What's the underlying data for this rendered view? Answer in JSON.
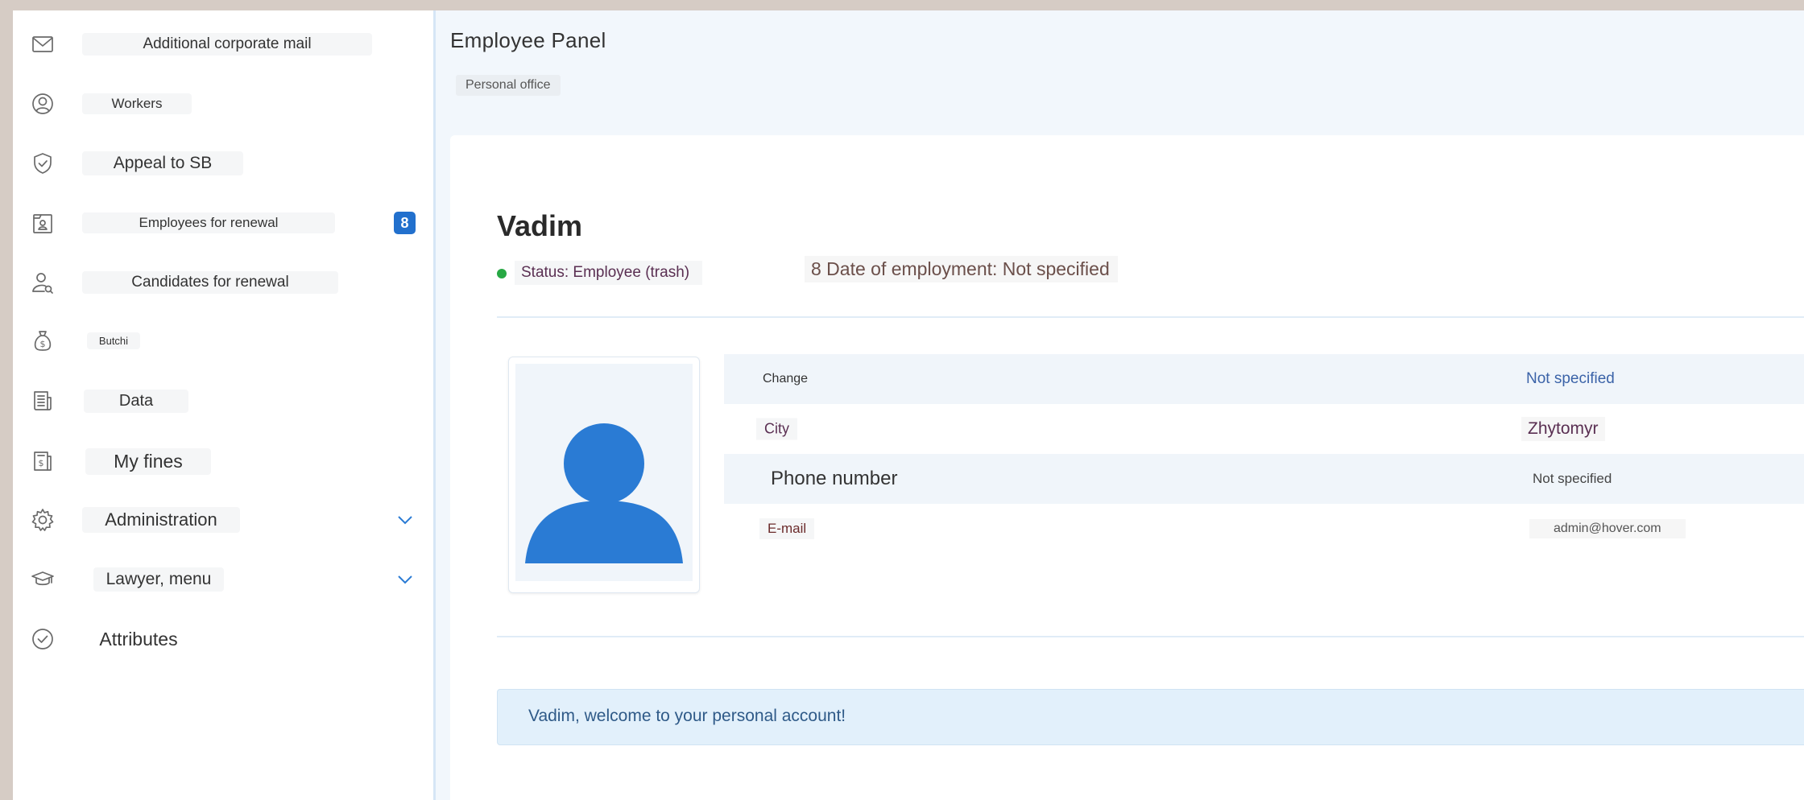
{
  "sidebar": {
    "items": [
      {
        "label": "Additional corporate mail",
        "icon": "mail-icon"
      },
      {
        "label": "Workers",
        "icon": "user-circle-icon"
      },
      {
        "label": "Appeal to SB",
        "icon": "shield-check-icon"
      },
      {
        "label": "Employees for renewal",
        "icon": "id-card-icon",
        "badge": "8"
      },
      {
        "label": "Candidates for renewal",
        "icon": "user-search-icon"
      },
      {
        "label": "Butchi",
        "icon": "money-bag-icon"
      },
      {
        "label": "Data",
        "icon": "document-icon"
      },
      {
        "label": "My fines",
        "icon": "receipt-icon"
      },
      {
        "label": "Administration",
        "icon": "gear-icon",
        "expandable": true
      },
      {
        "label": "Lawyer, menu",
        "icon": "graduation-cap-icon",
        "expandable": true
      },
      {
        "label": "Attributes",
        "icon": "check-circle-icon"
      }
    ]
  },
  "header": {
    "title": "Employee Panel",
    "breadcrumb": "Personal office"
  },
  "profile": {
    "name": "Vadim",
    "status": "Status: Employee (trash)",
    "employment": "8 Date of employment: Not specified",
    "fields": [
      {
        "key": "Change",
        "value": "Not specified"
      },
      {
        "key": "City",
        "value": "Zhytomyr"
      },
      {
        "key": "Phone number",
        "value": "Not specified"
      },
      {
        "key": "E-mail",
        "value": "admin@hover.com"
      }
    ]
  },
  "welcome": {
    "message": "Vadim, welcome to your personal account!"
  },
  "colors": {
    "accent": "#2270cd",
    "avatar": "#2a7bd4",
    "status_dot": "#27a844",
    "welcome_bg": "#e2f0fb"
  }
}
